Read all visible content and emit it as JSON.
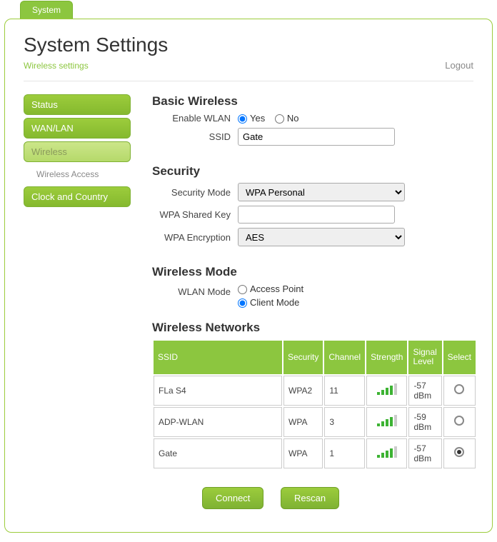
{
  "top_tab": "System",
  "header": {
    "title": "System Settings",
    "breadcrumb": "Wireless settings",
    "logout": "Logout"
  },
  "sidebar": {
    "items": [
      {
        "label": "Status",
        "active": false,
        "sub": false
      },
      {
        "label": "WAN/LAN",
        "active": false,
        "sub": false
      },
      {
        "label": "Wireless",
        "active": true,
        "sub": false
      },
      {
        "label": "Wireless Access",
        "active": false,
        "sub": true
      },
      {
        "label": "Clock and Country",
        "active": false,
        "sub": false
      }
    ]
  },
  "basic": {
    "heading": "Basic Wireless",
    "enable_label": "Enable WLAN",
    "enable_yes": "Yes",
    "enable_no": "No",
    "ssid_label": "SSID",
    "ssid_value": "Gate"
  },
  "security": {
    "heading": "Security",
    "mode_label": "Security Mode",
    "mode_value": "WPA Personal",
    "key_label": "WPA Shared Key",
    "key_value": "",
    "enc_label": "WPA Encryption",
    "enc_value": "AES"
  },
  "mode": {
    "heading": "Wireless Mode",
    "label": "WLAN Mode",
    "opt_ap": "Access Point",
    "opt_client": "Client Mode"
  },
  "networks": {
    "heading": "Wireless Networks",
    "cols": {
      "ssid": "SSID",
      "security": "Security",
      "channel": "Channel",
      "strength": "Strength",
      "signal": "Signal Level",
      "select": "Select"
    },
    "rows": [
      {
        "ssid": "FLa S4",
        "security": "WPA2",
        "channel": "11",
        "strength": 4,
        "signal": "-57 dBm",
        "selected": false
      },
      {
        "ssid": "ADP-WLAN",
        "security": "WPA",
        "channel": "3",
        "strength": 4,
        "signal": "-59 dBm",
        "selected": false
      },
      {
        "ssid": "Gate",
        "security": "WPA",
        "channel": "1",
        "strength": 4,
        "signal": "-57 dBm",
        "selected": true
      }
    ]
  },
  "buttons": {
    "connect": "Connect",
    "rescan": "Rescan"
  }
}
